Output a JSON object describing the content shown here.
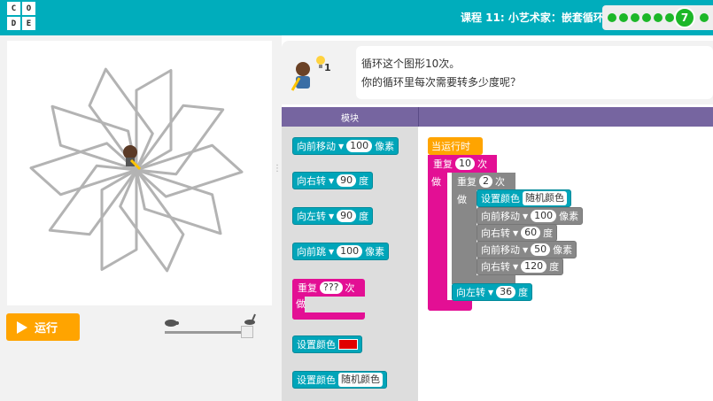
{
  "header": {
    "logo_letters": [
      "C",
      "O",
      "D",
      "E"
    ],
    "lesson_title": "课程 11: 小艺术家：嵌套循环",
    "current_level": "7",
    "accent": "#00adbc",
    "progress_color": "#1cb728"
  },
  "stage": {
    "run_label": "运行",
    "run_icon": "play-icon",
    "speed_slow_icon": "turtle-icon",
    "speed_fast_icon": "rabbit-icon"
  },
  "instructions": {
    "line1": "循环这个图形10次。",
    "line2": "你的循环里每次需要转多少度呢？",
    "hint_count": "1"
  },
  "workspace_header": {
    "toolbox_label": "模块"
  },
  "toolbox": {
    "move": {
      "label": "向前移动",
      "value": "100",
      "unit": "像素"
    },
    "turn_right": {
      "label": "向右转",
      "value": "90",
      "unit": "度"
    },
    "turn_left": {
      "label": "向左转",
      "value": "90",
      "unit": "度"
    },
    "jump": {
      "label": "向前跳",
      "value": "100",
      "unit": "像素"
    },
    "repeat": {
      "label": "重复",
      "value": "???",
      "unit": "次",
      "do": "做"
    },
    "set_color": {
      "label": "设置颜色"
    },
    "set_color_random": {
      "label": "设置颜色",
      "value": "随机颜色"
    }
  },
  "program": {
    "when_run": "当运行时",
    "outer_repeat": {
      "label": "重复",
      "value": "10",
      "unit": "次",
      "do": "做"
    },
    "inner_repeat": {
      "label": "重复",
      "value": "2",
      "unit": "次",
      "do": "做"
    },
    "set_color": {
      "label": "设置颜色",
      "value": "随机颜色"
    },
    "move1": {
      "label": "向前移动",
      "value": "100",
      "unit": "像素"
    },
    "right1": {
      "label": "向右转",
      "value": "60",
      "unit": "度"
    },
    "move2": {
      "label": "向前移动",
      "value": "50",
      "unit": "像素"
    },
    "right2": {
      "label": "向右转",
      "value": "120",
      "unit": "度"
    },
    "left": {
      "label": "向左转",
      "value": "36",
      "unit": "度"
    }
  }
}
